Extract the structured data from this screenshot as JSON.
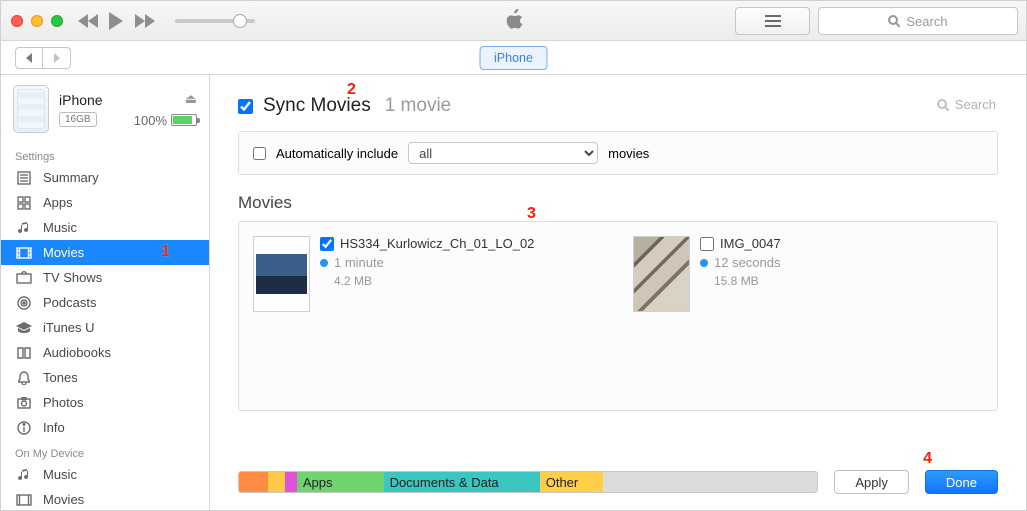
{
  "titlebar": {
    "search_placeholder": "Search"
  },
  "secondbar": {
    "tab_label": "iPhone"
  },
  "device": {
    "name": "iPhone",
    "capacity": "16GB",
    "battery_pct": "100%"
  },
  "sidebar": {
    "settings_header": "Settings",
    "items": [
      {
        "label": "Summary"
      },
      {
        "label": "Apps"
      },
      {
        "label": "Music"
      },
      {
        "label": "Movies"
      },
      {
        "label": "TV Shows"
      },
      {
        "label": "Podcasts"
      },
      {
        "label": "iTunes U"
      },
      {
        "label": "Audiobooks"
      },
      {
        "label": "Tones"
      },
      {
        "label": "Photos"
      },
      {
        "label": "Info"
      }
    ],
    "onmydevice_header": "On My Device",
    "device_items": [
      {
        "label": "Music"
      },
      {
        "label": "Movies"
      }
    ]
  },
  "sync": {
    "title": "Sync Movies",
    "count": "1 movie",
    "auto_label": "Automatically include",
    "auto_select_value": "all",
    "auto_suffix": "movies",
    "search_placeholder": "Search"
  },
  "movies": {
    "header": "Movies",
    "items": [
      {
        "name": "HS334_Kurlowicz_Ch_01_LO_02",
        "duration": "1 minute",
        "size": "4.2 MB",
        "checked": true
      },
      {
        "name": "IMG_0047",
        "duration": "12 seconds",
        "size": "15.8 MB",
        "checked": false
      }
    ]
  },
  "storage": {
    "segments": [
      {
        "label": ""
      },
      {
        "label": ""
      },
      {
        "label": ""
      },
      {
        "label": "Apps"
      },
      {
        "label": "Documents & Data"
      },
      {
        "label": "Other"
      },
      {
        "label": ""
      }
    ]
  },
  "buttons": {
    "apply": "Apply",
    "done": "Done"
  },
  "annotations": {
    "a1": "1",
    "a2": "2",
    "a3": "3",
    "a4": "4"
  }
}
